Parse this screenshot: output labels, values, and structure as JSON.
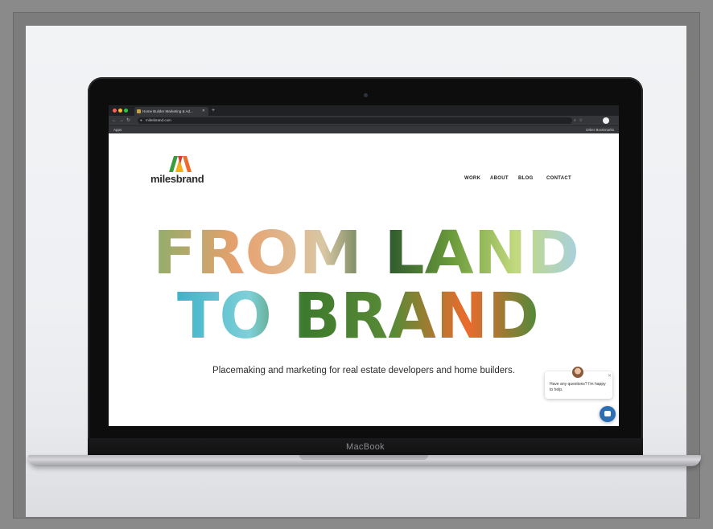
{
  "browser": {
    "tab_title": "Home Builder Marketing & Ad...",
    "url": "milesbrand.com",
    "bookmarks_apps": "Apps",
    "bookmarks_other": "Other Bookmarks"
  },
  "site": {
    "logo_text": "milesbrand",
    "nav": [
      {
        "label": "WORK"
      },
      {
        "label": "ABOUT"
      },
      {
        "label": "BLOG"
      },
      {
        "label": "CONTACT"
      }
    ],
    "headline_line1": "FROM LAND",
    "headline_line2": "TO BRAND",
    "tagline": "Placemaking and marketing for real estate developers and home builders.",
    "chat_message": "Have any questions? I'm happy to help."
  },
  "device_label": "MacBook",
  "colors": {
    "logo_green": "#3a9b3f",
    "logo_orange": "#ec6b2d",
    "logo_red": "#d93a3a",
    "chat_blue": "#2a6fb3"
  },
  "icons": [
    "close-icon",
    "plus-icon",
    "lock-icon",
    "search-icon",
    "chat-icon"
  ]
}
